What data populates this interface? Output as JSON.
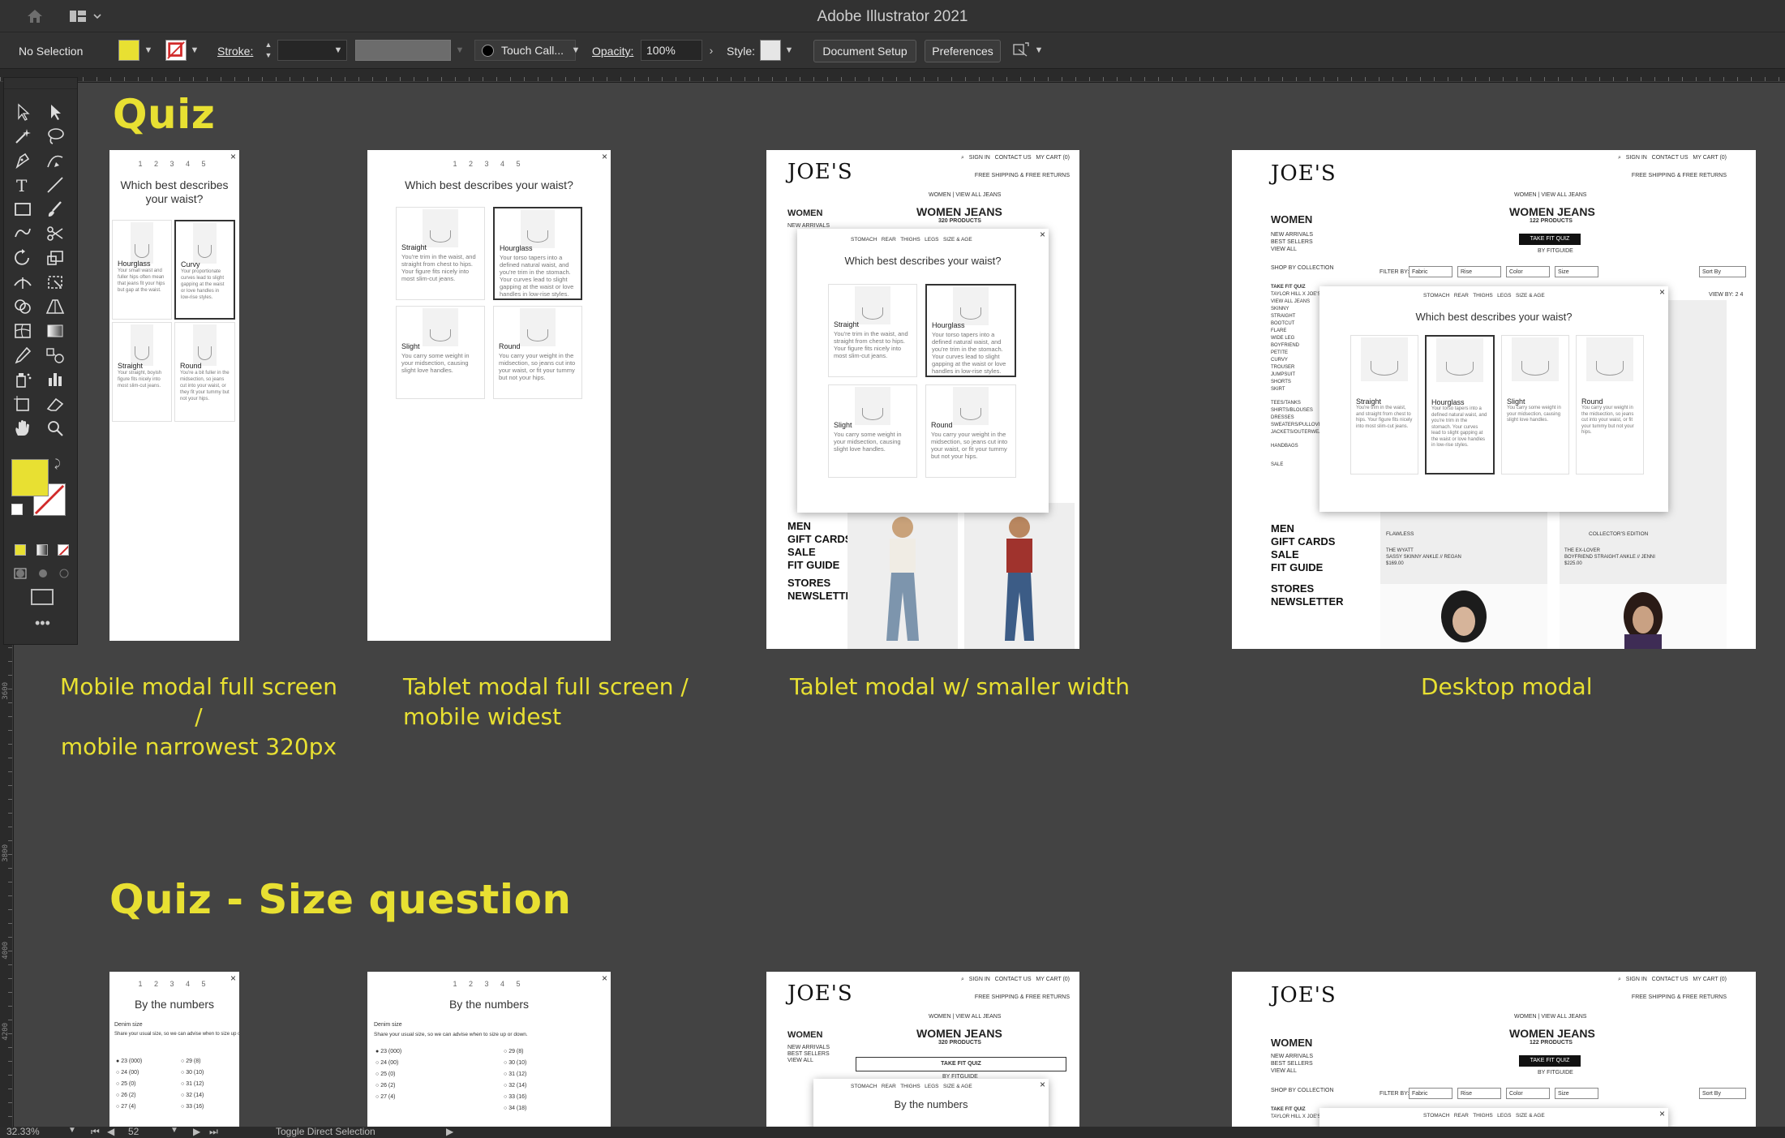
{
  "app": {
    "title": "Adobe Illustrator 2021"
  },
  "control_bar": {
    "selection": "No Selection",
    "fill_color": "#e8e032",
    "stroke_label": "Stroke:",
    "brush_label": "Touch Call...",
    "opacity_label": "Opacity:",
    "opacity_value": "100%",
    "style_label": "Style:",
    "document_setup": "Document Setup",
    "preferences": "Preferences"
  },
  "headings": {
    "quiz": "Quiz",
    "size_question": "Quiz - Size question"
  },
  "captions": {
    "mobile": [
      "Mobile modal full screen /",
      "mobile narrowest 320px"
    ],
    "tablet_full": [
      "Tablet modal full screen /",
      "mobile widest"
    ],
    "tablet_small": "Tablet modal w/ smaller width",
    "desktop": "Desktop modal"
  },
  "quiz": {
    "steps": "1 2 3 4 5",
    "question": "Which best describes your waist?",
    "question_mobile_l1": "Which best describes",
    "question_mobile_l2": "your waist?",
    "mobile_options": [
      {
        "title": "Hourglass",
        "desc": "Your small waist and fuller hips often mean that jeans fit your hips but gap at the waist."
      },
      {
        "title": "Curvy",
        "desc": "Your proportionate curves lead to slight gapping at the waist or love handles in low-rise styles."
      },
      {
        "title": "Straight",
        "desc": "Your straight, boyish figure fits nicely into most slim-cut jeans."
      },
      {
        "title": "Round",
        "desc": "You're a bit fuller in the midsection, so jeans cut into your waist, or they fit your tummy but not your hips."
      }
    ],
    "options": [
      {
        "title": "Straight",
        "desc": "You're trim in the waist, and straight from chest to hips. Your figure fits nicely into most slim-cut jeans."
      },
      {
        "title": "Hourglass",
        "desc": "Your torso tapers into a defined natural waist, and you're trim in the stomach. Your curves lead to slight gapping at the waist or love handles in low-rise styles."
      },
      {
        "title": "Slight",
        "desc": "You carry some weight in your midsection, causing slight love handles."
      },
      {
        "title": "Round",
        "desc": "You carry your weight in the midsection, so jeans cut into your waist, or fit your tummy but not your hips."
      }
    ],
    "tabs": [
      "STOMACH",
      "REAR",
      "THIGHS",
      "LEGS",
      "SIZE & AGE"
    ]
  },
  "site": {
    "logo": "JOE'S",
    "top_links": [
      "SIGN IN",
      "CONTACT US",
      "MY CART (0)"
    ],
    "shipping": "FREE SHIPPING & FREE RETURNS",
    "breadcrumb": "WOMEN | VIEW ALL JEANS",
    "page_title": "WOMEN JEANS",
    "count_tablet": "320 PRODUCTS",
    "count_desktop": "122 PRODUCTS",
    "cta": "TAKE FIT QUIZ",
    "by_fitguide": "BY FITGUIDE",
    "nav_head": "WOMEN",
    "nav_small": [
      "NEW ARRIVALS",
      "BEST SELLERS",
      "VIEW ALL"
    ],
    "shop_by": "SHOP BY COLLECTION",
    "take_fit": "TAKE FIT QUIZ",
    "collection": [
      "TAYLOR HILL X JOE'S",
      "VIEW ALL JEANS",
      "SKINNY",
      "STRAIGHT",
      "BOOTCUT",
      "FLARE",
      "WIDE LEG",
      "BOYFRIEND",
      "PETITE",
      "CURVY",
      "TROUSER",
      "JUMPSUIT",
      "SHORTS",
      "SKIRT"
    ],
    "collection2": [
      "TEES/TANKS",
      "SHIRTS/BLOUSES",
      "DRESSES",
      "SWEATERS/PULLOVERS",
      "JACKETS/OUTERWEAR"
    ],
    "handbags": "HANDBAGS",
    "sale": "SALE",
    "big_links": [
      "MEN",
      "GIFT CARDS",
      "SALE",
      "FIT GUIDE"
    ],
    "big_links2": [
      "STORES",
      "NEWSLETTER"
    ],
    "filter_by": "FILTER BY:",
    "filters": [
      "Fabric",
      "Rise",
      "Color",
      "Size"
    ],
    "sort": "Sort By",
    "view_by": "VIEW BY: 2  4",
    "product_badges": [
      "FLAWLESS",
      "COLLECTOR'S EDITION"
    ],
    "products": [
      {
        "name": "THE WYATT",
        "sub": "SASSY SKINNY ANKLE // REGAN",
        "price": "$169.00"
      },
      {
        "name": "THE EX-LOVER",
        "sub": "BOYFRIEND STRAIGHT ANKLE // JENNI",
        "price": "$225.00"
      }
    ]
  },
  "size_quiz": {
    "title": "By the numbers",
    "section": "Denim size",
    "hint": "Share your usual size, so we can advise when to size up or down.",
    "col1": [
      "23 (000)",
      "24 (00)",
      "25 (0)",
      "26 (2)",
      "27 (4)"
    ],
    "col2": [
      "29 (8)",
      "30 (10)",
      "31 (12)",
      "32 (14)",
      "33 (16)",
      "34 (18)"
    ]
  },
  "status_bar": {
    "zoom": "32.33%",
    "artboard": "52",
    "tool": "Toggle Direct Selection"
  },
  "rulers": {
    "left_marks": [
      "3600",
      "3800",
      "4000",
      "4200"
    ]
  }
}
